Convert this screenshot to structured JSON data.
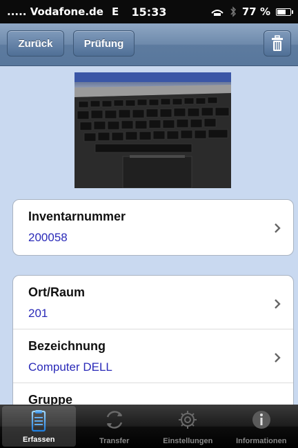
{
  "status": {
    "carrier": "..... Vodafone.de",
    "network": "E",
    "time": "15:33",
    "battery": "77 %",
    "battery_level": 0.77
  },
  "nav": {
    "back_label": "Zurück",
    "check_label": "Prüfung"
  },
  "groups": [
    {
      "cells": [
        {
          "label": "Inventarnummer",
          "value": "200058"
        }
      ]
    },
    {
      "cells": [
        {
          "label": "Ort/Raum",
          "value": "201"
        },
        {
          "label": "Bezeichnung",
          "value": "Computer DELL"
        },
        {
          "label": "Gruppe",
          "value": ""
        }
      ]
    }
  ],
  "tabs": [
    {
      "label": "Erfassen",
      "icon": "clipboard-icon",
      "active": true
    },
    {
      "label": "Transfer",
      "icon": "refresh-icon",
      "active": false
    },
    {
      "label": "Einstellungen",
      "icon": "gear-icon",
      "active": false
    },
    {
      "label": "Informationen",
      "icon": "info-icon",
      "active": false
    }
  ]
}
